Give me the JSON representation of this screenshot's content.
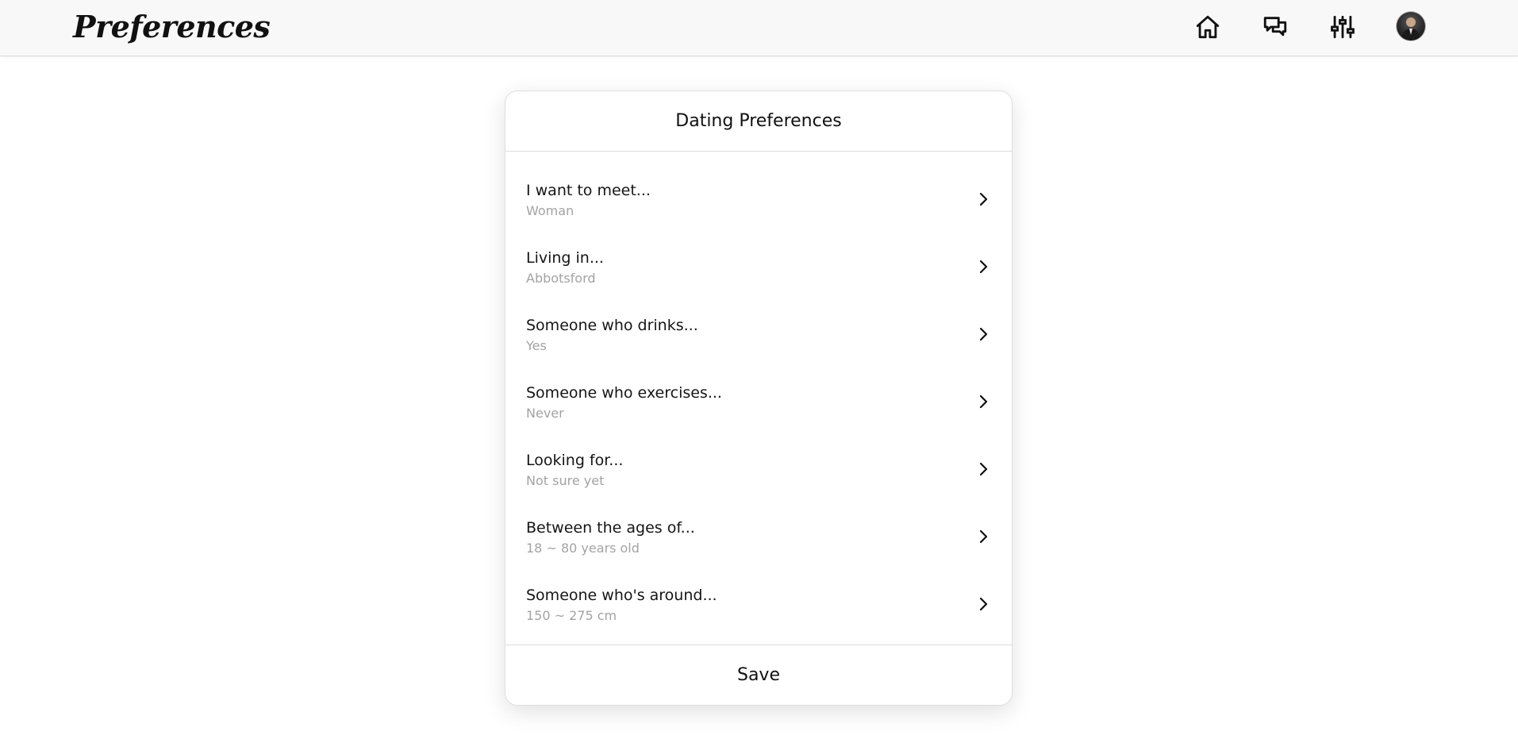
{
  "header": {
    "brand": "Preferences",
    "icons": [
      "home-icon",
      "chat-icon",
      "sliders-icon"
    ],
    "avatar": "user-avatar"
  },
  "card": {
    "title": "Dating Preferences",
    "items": [
      {
        "title": "I want to meet...",
        "value": "Woman"
      },
      {
        "title": "Living in...",
        "value": "Abbotsford"
      },
      {
        "title": "Someone who drinks...",
        "value": "Yes"
      },
      {
        "title": "Someone who exercises...",
        "value": "Never"
      },
      {
        "title": "Looking for...",
        "value": "Not sure yet"
      },
      {
        "title": "Between the ages of...",
        "value": "18 ~ 80 years old"
      },
      {
        "title": "Someone who's around...",
        "value": "150 ~ 275 cm"
      }
    ],
    "save_label": "Save"
  }
}
